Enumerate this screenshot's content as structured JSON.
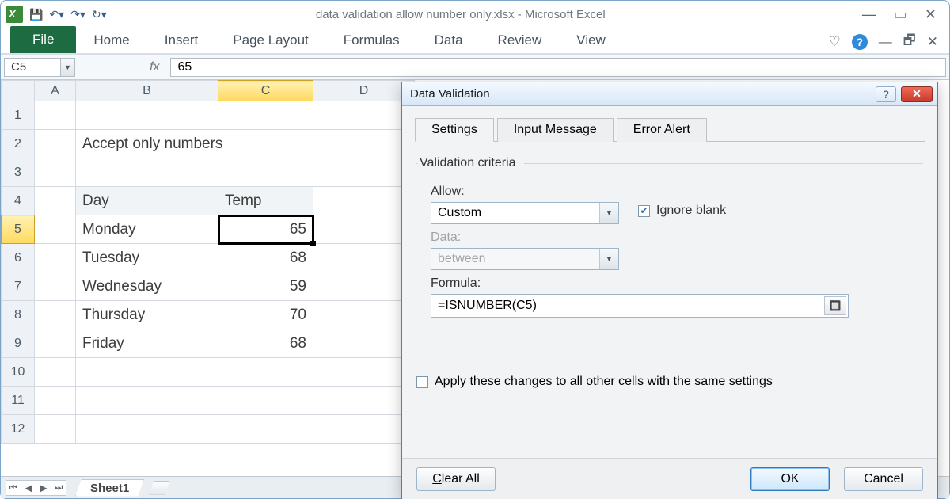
{
  "titlebar": {
    "document": "data validation allow number only.xlsx",
    "app": "Microsoft Excel",
    "separator": "  -  "
  },
  "ribbon": {
    "file": "File",
    "tabs": [
      "Home",
      "Insert",
      "Page Layout",
      "Formulas",
      "Data",
      "Review",
      "View"
    ]
  },
  "namebox": "C5",
  "formula_bar_value": "65",
  "columns": [
    "A",
    "B",
    "C",
    "D"
  ],
  "rows": [
    "1",
    "2",
    "3",
    "4",
    "5",
    "6",
    "7",
    "8",
    "9",
    "10",
    "11",
    "12"
  ],
  "sheet": {
    "title": "Accept only numbers",
    "header_day": "Day",
    "header_temp": "Temp",
    "data": [
      {
        "day": "Monday",
        "temp": "65"
      },
      {
        "day": "Tuesday",
        "temp": "68"
      },
      {
        "day": "Wednesday",
        "temp": "59"
      },
      {
        "day": "Thursday",
        "temp": "70"
      },
      {
        "day": "Friday",
        "temp": "68"
      }
    ],
    "active_cell": "C5",
    "tab_name": "Sheet1"
  },
  "dialog": {
    "title": "Data Validation",
    "tabs": {
      "settings": "Settings",
      "input": "Input Message",
      "error": "Error Alert"
    },
    "criteria_legend": "Validation criteria",
    "allow_label_pre": "A",
    "allow_label_post": "llow:",
    "allow_value": "Custom",
    "ignore_blank_pre": "Ignore ",
    "ignore_blank_ul": "b",
    "ignore_blank_post": "lank",
    "ignore_blank_checked": true,
    "data_label_pre": "D",
    "data_label_post": "ata:",
    "data_value": "between",
    "formula_label_pre": "F",
    "formula_label_post": "ormula:",
    "formula_value": "=ISNUMBER(C5)",
    "apply_label_pre": "Apply these changes to all other cells with the same settings",
    "apply_checked": false,
    "clear_all_pre": "C",
    "clear_all_post": "lear All",
    "ok": "OK",
    "cancel": "Cancel"
  }
}
